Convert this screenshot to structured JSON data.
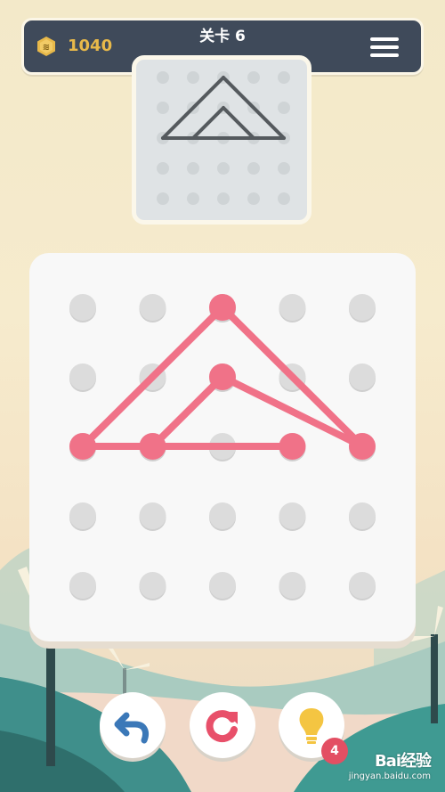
{
  "header": {
    "coins": "1040",
    "level_label": "关卡 6"
  },
  "puzzle": {
    "grid": {
      "rows": 5,
      "cols": 5
    },
    "target_segments": [
      [
        [
          0,
          2
        ],
        [
          2,
          0
        ]
      ],
      [
        [
          2,
          0
        ],
        [
          4,
          2
        ]
      ],
      [
        [
          0,
          2
        ],
        [
          4,
          2
        ]
      ],
      [
        [
          1,
          2
        ],
        [
          2,
          1
        ]
      ],
      [
        [
          2,
          1
        ],
        [
          3,
          2
        ]
      ]
    ],
    "drawn_segments": [
      [
        [
          0,
          2
        ],
        [
          2,
          0
        ]
      ],
      [
        [
          2,
          0
        ],
        [
          4,
          2
        ]
      ],
      [
        [
          0,
          2
        ],
        [
          1,
          2
        ]
      ],
      [
        [
          1,
          2
        ],
        [
          3,
          2
        ]
      ],
      [
        [
          1,
          2
        ],
        [
          2,
          1
        ]
      ],
      [
        [
          2,
          1
        ],
        [
          4,
          2
        ]
      ]
    ],
    "active_dots": [
      [
        2,
        0
      ],
      [
        2,
        1
      ],
      [
        0,
        2
      ],
      [
        1,
        2
      ],
      [
        3,
        2
      ],
      [
        4,
        2
      ]
    ]
  },
  "controls": {
    "hint_count": "4"
  },
  "watermark": {
    "brand": "Bai经验",
    "url": "jingyan.baidu.com"
  },
  "colors": {
    "header_bg": "#3f4a5a",
    "coin": "#e8b94a",
    "line": "#f07288",
    "dot": "#dcdcdc",
    "preview_line": "#555a5e",
    "badge": "#e34f63"
  }
}
